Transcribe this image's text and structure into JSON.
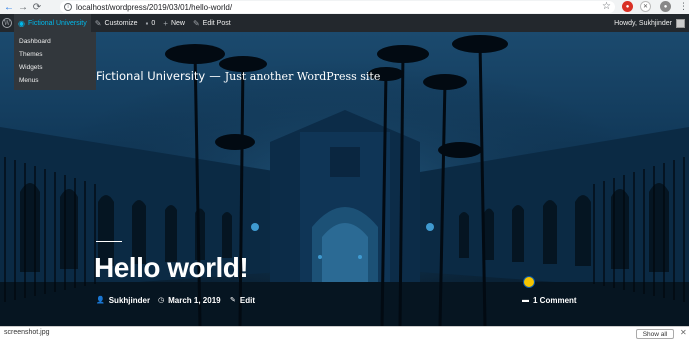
{
  "browser": {
    "url": "localhost/wordpress/2019/03/01/hello-world/",
    "icons": [
      "back-arrow",
      "forward-arrow",
      "reload",
      "info",
      "star",
      "extension",
      "menu"
    ]
  },
  "admin_bar": {
    "site_name": "Fictional University",
    "customize": "Customize",
    "comments_count": "0",
    "new": "New",
    "edit_post": "Edit Post",
    "howdy": "Howdy, Sukhjinder",
    "site_menu": [
      "Dashboard",
      "Themes",
      "Widgets",
      "Menus"
    ]
  },
  "hero": {
    "site_title": "Fictional University",
    "separator": "—",
    "tagline": "Just another WordPress site",
    "post_title": "Hello world!",
    "author": "Sukhjinder",
    "date": "March 1, 2019",
    "edit": "Edit",
    "comments": "1 Comment"
  },
  "downloads": {
    "file": "screenshot.jpg",
    "show_all": "Show all"
  },
  "colors": {
    "admin_bar": "#23282d",
    "site_accent": "#00b9eb",
    "hero_overlay": "#0a1f33"
  }
}
